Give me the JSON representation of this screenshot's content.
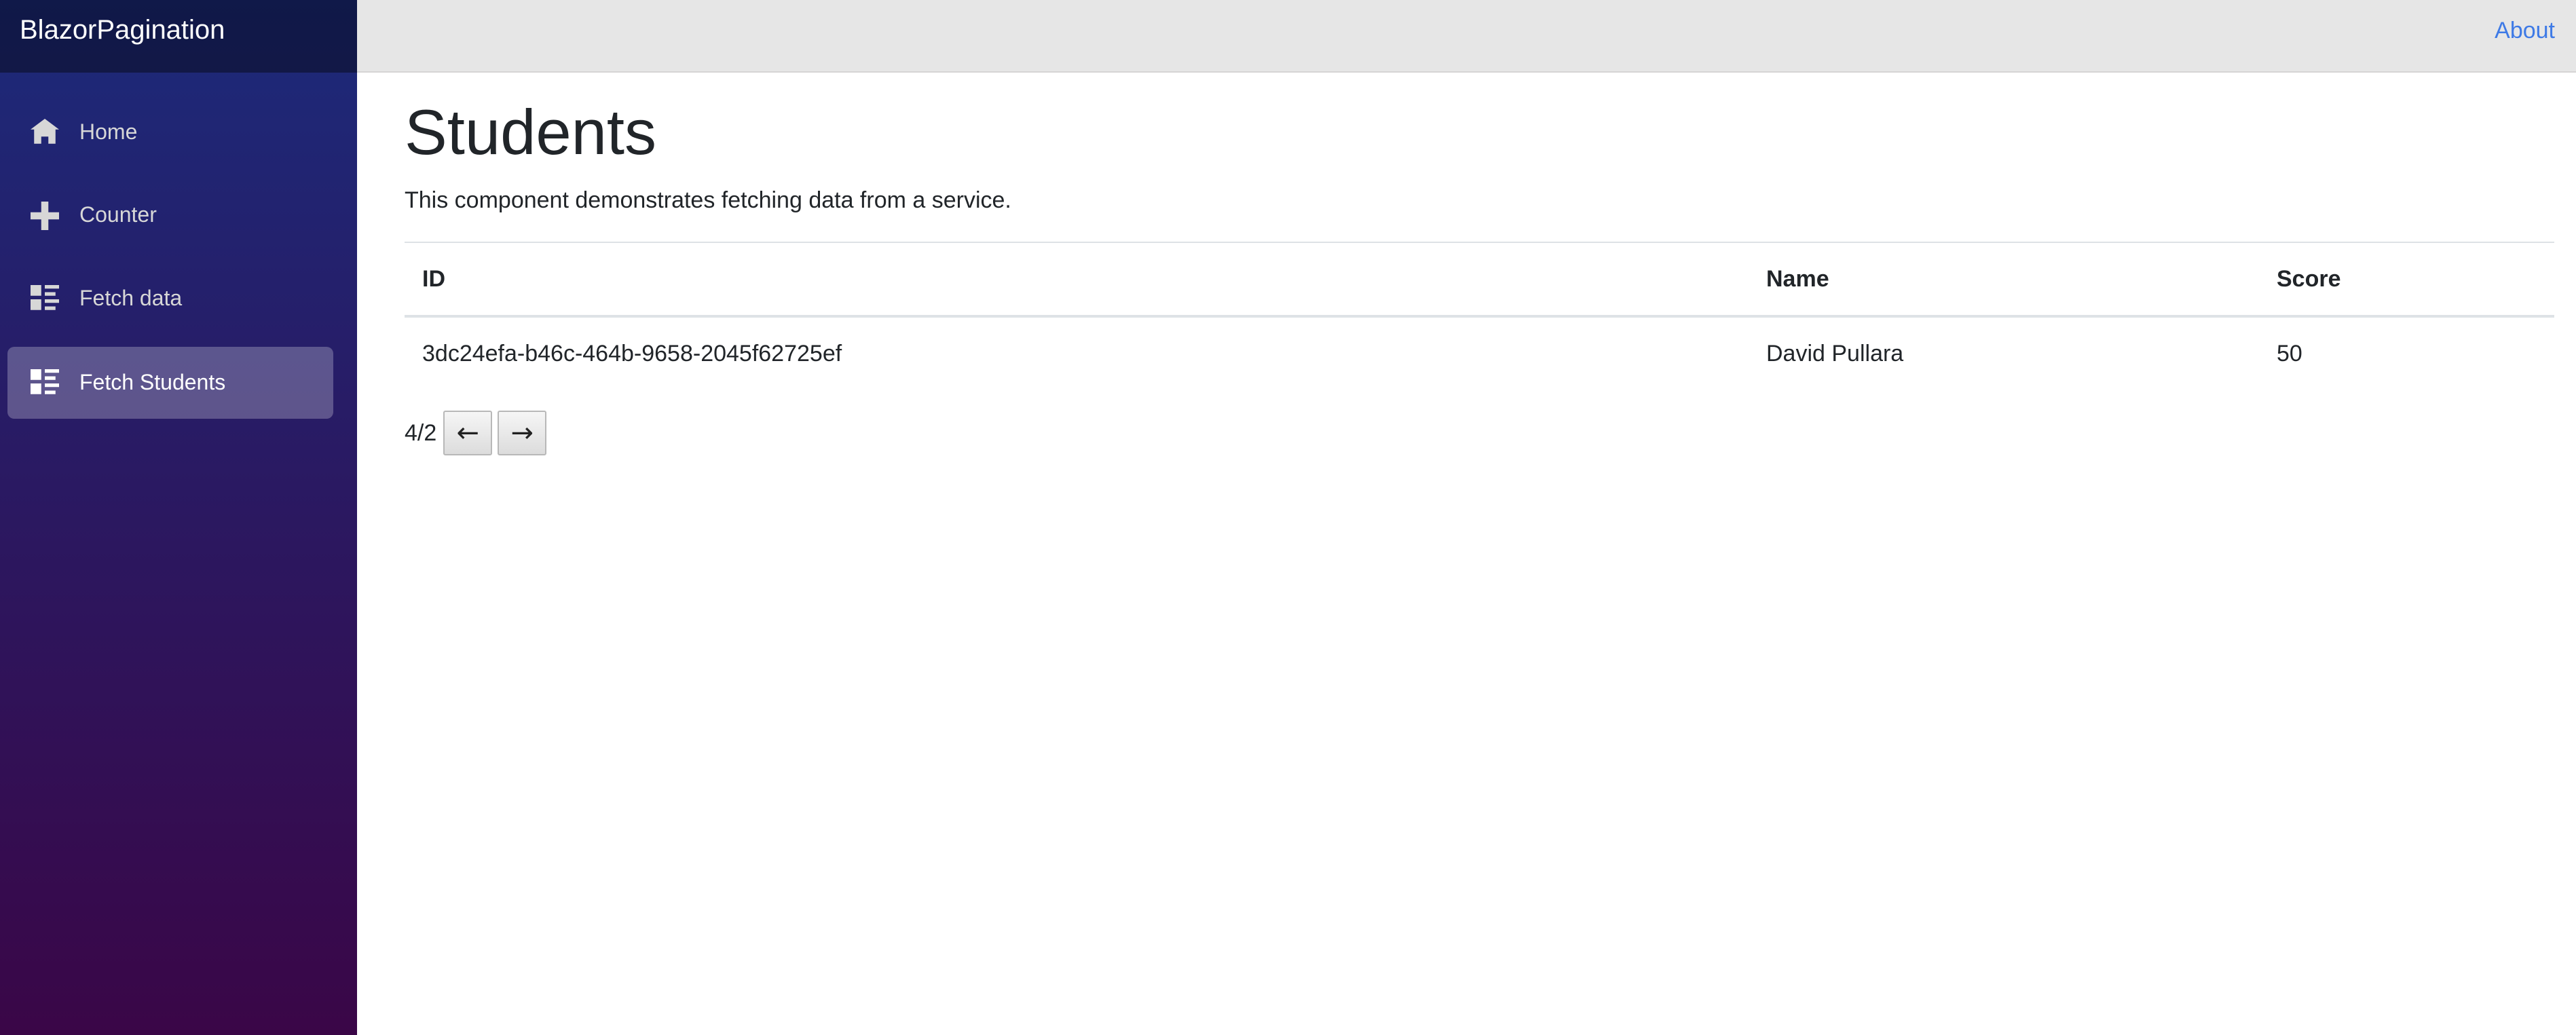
{
  "app": {
    "brand": "BlazorPagination"
  },
  "top_bar": {
    "about_label": "About"
  },
  "sidebar": {
    "items": [
      {
        "label": "Home",
        "icon": "home-icon",
        "active": false
      },
      {
        "label": "Counter",
        "icon": "plus-icon",
        "active": false
      },
      {
        "label": "Fetch data",
        "icon": "list-rich-icon",
        "active": false
      },
      {
        "label": "Fetch Students",
        "icon": "list-rich-icon",
        "active": true
      }
    ]
  },
  "main": {
    "title": "Students",
    "description": "This component demonstrates fetching data from a service.",
    "table": {
      "headers": [
        "ID",
        "Name",
        "Score"
      ],
      "rows": [
        [
          "3dc24efa-b46c-464b-9658-2045f62725ef",
          "David Pullara",
          "50"
        ]
      ]
    },
    "pager": {
      "info": "4/2",
      "prev_label": "←",
      "next_label": "→"
    }
  },
  "colors": {
    "sidebar_top": "#1c2a7a",
    "sidebar_bottom": "#3a0647",
    "top_bar": "#e6e6e6",
    "link": "#3e7ae6"
  }
}
